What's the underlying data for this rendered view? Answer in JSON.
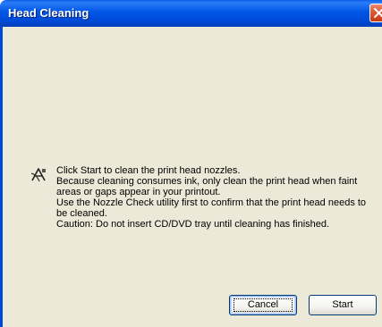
{
  "window": {
    "title": "Head Cleaning",
    "close_icon": "close-icon"
  },
  "message": {
    "icon": "print-head-cleaning-icon",
    "lines": [
      "Click Start to clean the print head nozzles.",
      "Because cleaning consumes ink, only clean the print head when faint areas or gaps appear in your printout.",
      "Use the Nozzle Check utility first to confirm that the print head needs to be cleaned.",
      "Caution: Do not insert CD/DVD tray until cleaning has finished."
    ]
  },
  "buttons": {
    "cancel_label": "Cancel",
    "start_label": "Start"
  },
  "colors": {
    "titlebar": "#0055e5",
    "dialog_background": "#ece9d8",
    "close_button": "#d9542f"
  }
}
